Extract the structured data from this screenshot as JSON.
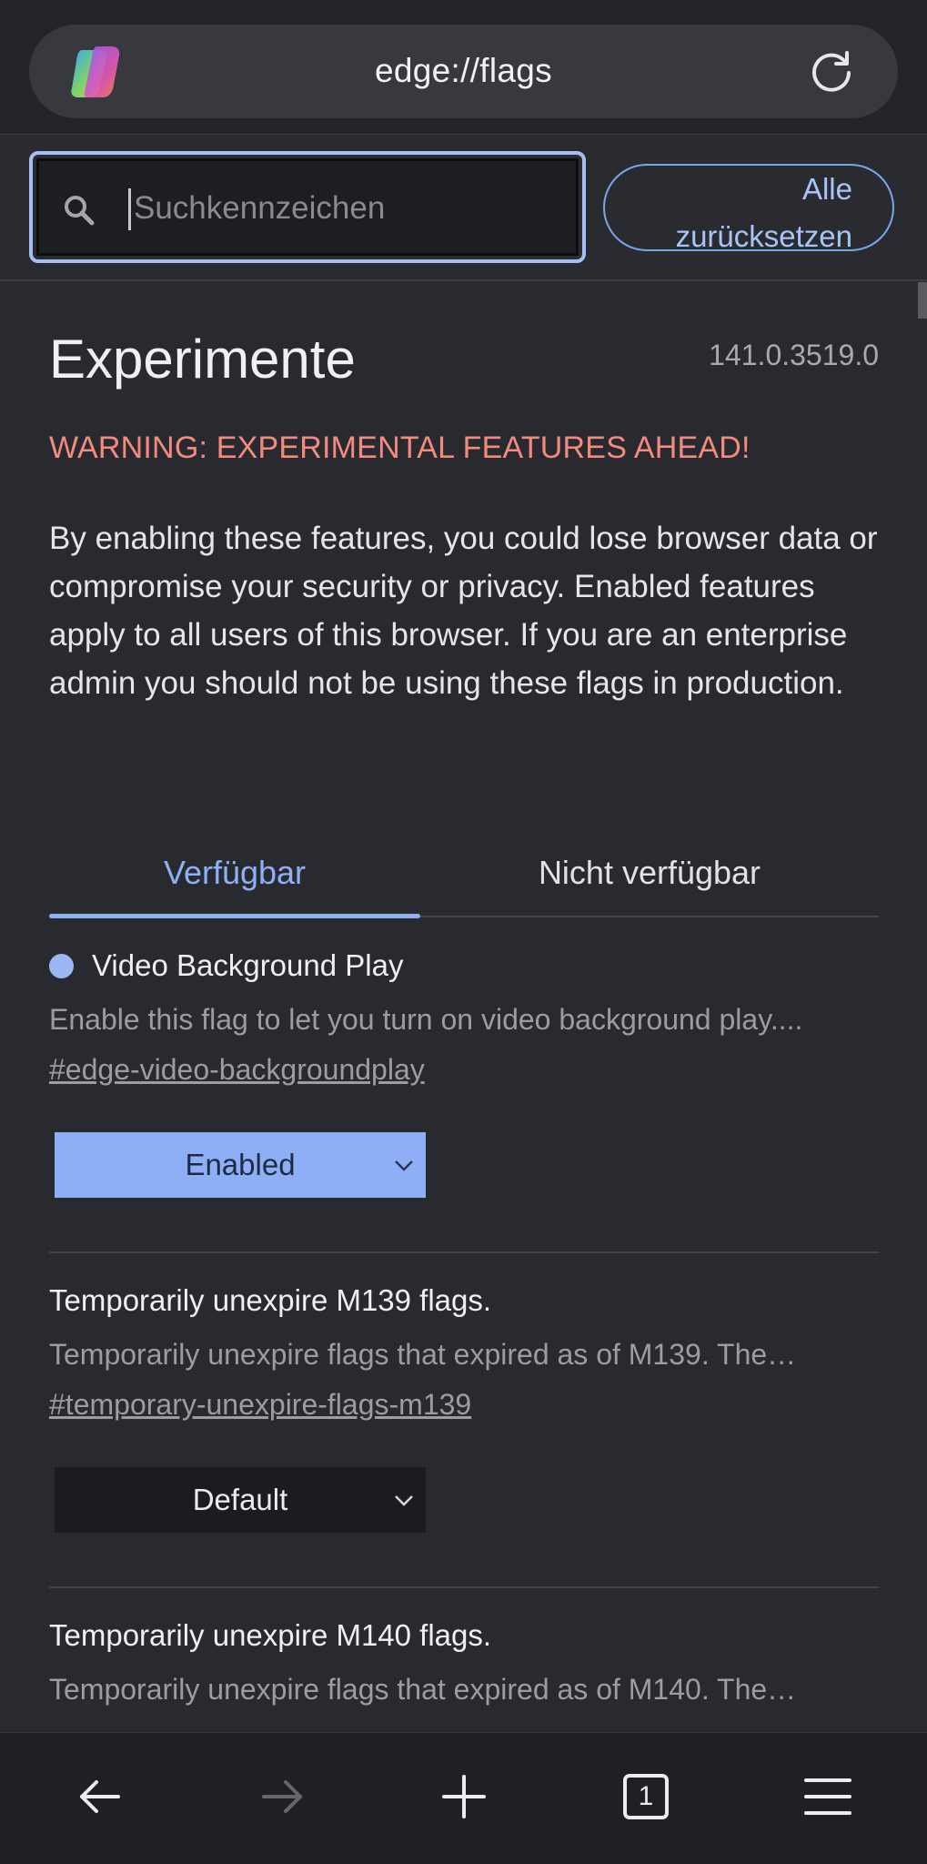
{
  "browser": {
    "url": "edge://flags"
  },
  "search": {
    "placeholder": "Suchkennzeichen",
    "reset_line1": "Alle",
    "reset_line2": "zurücksetzen"
  },
  "page": {
    "title": "Experimente",
    "version": "141.0.3519.0",
    "warning": "WARNING: EXPERIMENTAL FEATURES AHEAD!",
    "description": "By enabling these features, you could lose browser data or compromise your security or privacy. Enabled features apply to all users of this browser. If you are an enterprise admin you should not be using these flags in production."
  },
  "tabs": [
    {
      "label": "Verfügbar",
      "active": true
    },
    {
      "label": "Nicht verfügbar",
      "active": false
    }
  ],
  "flags": [
    {
      "title": "Video Background Play",
      "description": "Enable this flag to let you turn on video background play....",
      "link": "#edge-video-backgroundplay",
      "value": "Enabled",
      "modified": true
    },
    {
      "title": "Temporarily unexpire M139 flags.",
      "description": "Temporarily unexpire flags that expired as of M139. The…",
      "link": "#temporary-unexpire-flags-m139",
      "value": "Default",
      "modified": false
    },
    {
      "title": "Temporarily unexpire M140 flags.",
      "description": "Temporarily unexpire flags that expired as of M140. The…"
    }
  ],
  "bottom_nav": {
    "tab_count": "1",
    "icons": [
      "back-arrow-icon",
      "forward-arrow-icon",
      "plus-icon",
      "tabs-icon",
      "menu-icon"
    ]
  },
  "colors": {
    "accent": "#8fb0f5",
    "warning": "#f28b7d",
    "background": "#292a2f"
  }
}
